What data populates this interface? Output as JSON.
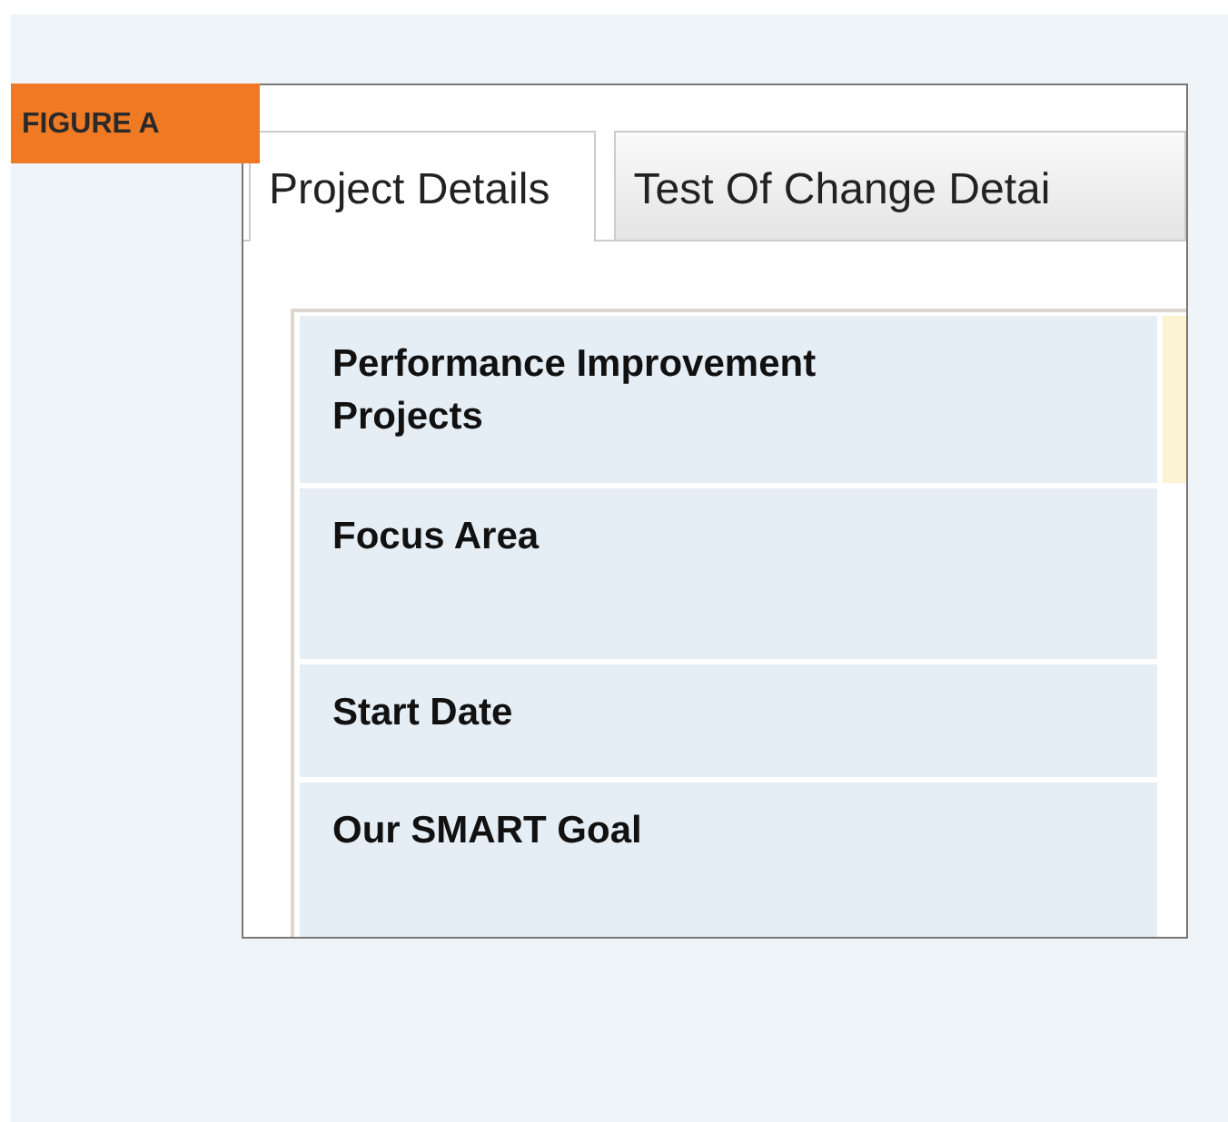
{
  "figure_label": "FIGURE A",
  "tabs": [
    {
      "label": "Project Details",
      "selected": true
    },
    {
      "label": "Test Of Change Detai",
      "selected": false
    }
  ],
  "rows": [
    {
      "label": "Performance Improvement Projects",
      "highlighted": true
    },
    {
      "label": "Focus Area",
      "highlighted": false
    },
    {
      "label": "Start Date",
      "highlighted": false
    },
    {
      "label": "Our SMART Goal",
      "highlighted": false
    }
  ]
}
